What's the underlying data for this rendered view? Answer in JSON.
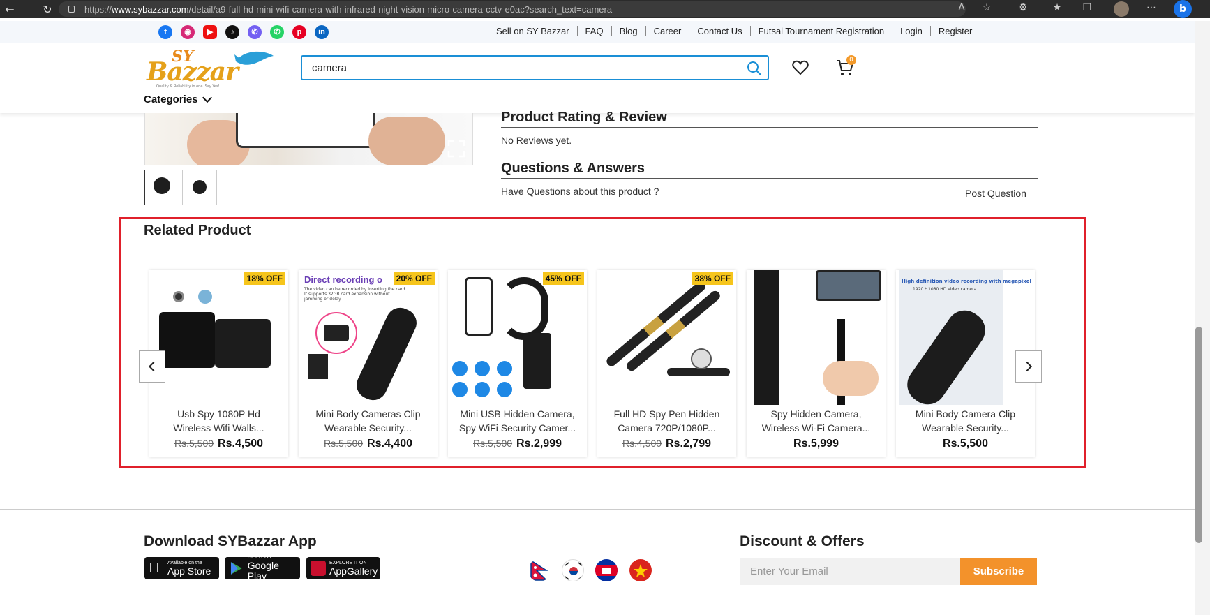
{
  "browser": {
    "url_prefix": "https://",
    "url_domain": "www.sybazzar.com",
    "url_path": "/detail/a9-full-hd-mini-wifi-camera-with-infrared-night-vision-micro-camera-cctv-e0ac?search_text=camera"
  },
  "topbar": {
    "links": [
      "Sell on SY Bazzar",
      "FAQ",
      "Blog",
      "Career",
      "Contact Us",
      "Futsal Tournament Registration",
      "Login",
      "Register"
    ]
  },
  "header": {
    "logo_sy": "SY",
    "logo_bazzar": "Bazzar",
    "logo_tagline": "Quality & Reliability in one. Say Yes!",
    "search_value": "camera",
    "cart_count": "0",
    "categories_label": "Categories"
  },
  "review": {
    "rating_title": "Product Rating & Review",
    "no_reviews": "No Reviews yet.",
    "qa_title": "Questions & Answers",
    "qa_prompt": "Have Questions about this product ?",
    "post_question": "Post Question"
  },
  "related": {
    "title": "Related Product",
    "products": [
      {
        "badge": "18% OFF",
        "name1": "Usb Spy 1080P Hd",
        "name2": "Wireless Wifi Walls...",
        "old_price": "Rs.5,500",
        "price": "Rs.4,500"
      },
      {
        "badge": "20% OFF",
        "name1": "Mini Body Cameras Clip",
        "name2": "Wearable Security...",
        "old_price": "Rs.5,500",
        "price": "Rs.4,400",
        "img_caption": "Direct recording o",
        "img_sub": "The video can be recorded by inserting the card. It supports 32GB card expansion without jamming or delay"
      },
      {
        "badge": "45% OFF",
        "name1": "Mini USB Hidden Camera,",
        "name2": "Spy WiFi Security Camer...",
        "old_price": "Rs.5,500",
        "price": "Rs.2,999"
      },
      {
        "badge": "38% OFF",
        "name1": "Full HD Spy Pen Hidden",
        "name2": "Camera 720P/1080P...",
        "old_price": "Rs.4,500",
        "price": "Rs.2,799"
      },
      {
        "badge": "",
        "name1": "Spy Hidden Camera,",
        "name2": "Wireless Wi-Fi Camera...",
        "old_price": "",
        "price": "Rs.5,999"
      },
      {
        "badge": "",
        "name1": "Mini Body Camera Clip",
        "name2": "Wearable Security...",
        "old_price": "",
        "price": "Rs.5,500",
        "img_caption": "High definition video recording with megapixel",
        "img_sub": "1920 * 1080 HD video camera"
      }
    ]
  },
  "footer": {
    "app_title": "Download SYBazzar App",
    "appstore_small": "Available on the",
    "appstore_large": "App Store",
    "google_small": "GET IT ON",
    "google_large": "Google Play",
    "huawei_small": "EXPLORE IT ON",
    "huawei_large": "AppGallery",
    "offers_title": "Discount & Offers",
    "email_placeholder": "Enter Your Email",
    "subscribe_label": "Subscribe"
  },
  "colors": {
    "accent": "#1a8fd6",
    "highlight_border": "#e0202b",
    "badge": "#f6c51c",
    "subscribe": "#f3922b"
  }
}
